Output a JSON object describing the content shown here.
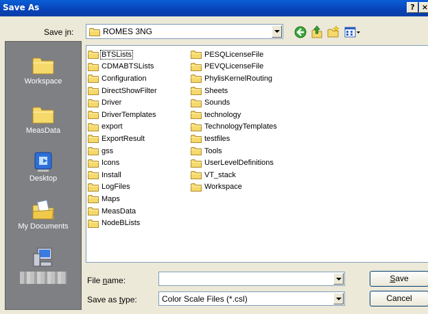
{
  "window": {
    "title": "Save As",
    "help_label": "?",
    "close_label": "×"
  },
  "toolbar": {
    "save_in_label_pre": "Save ",
    "save_in_label_u": "i",
    "save_in_label_post": "n:",
    "save_in_value": "ROMES 3NG",
    "icons": [
      "back-icon",
      "up-folder-icon",
      "new-folder-icon",
      "views-menu-icon"
    ]
  },
  "places": [
    {
      "label": "Workspace",
      "icon": "folder-icon"
    },
    {
      "label": "MeasData",
      "icon": "folder-icon"
    },
    {
      "label": "Desktop",
      "icon": "desktop-icon"
    },
    {
      "label": "My Documents",
      "icon": "my-documents-icon"
    },
    {
      "label": "",
      "icon": "my-computer-icon"
    }
  ],
  "files": {
    "column1": [
      "BTSLists",
      "CDMABTSLists",
      "Configuration",
      "DirectShowFilter",
      "Driver",
      "DriverTemplates",
      "export",
      "ExportResult",
      "gss",
      "Icons",
      "Install",
      "LogFiles",
      "Maps",
      "MeasData",
      "NodeBLists"
    ],
    "column2": [
      "PESQLicenseFile",
      "PEVQLicenseFile",
      "PhylisKernelRouting",
      "Sheets",
      "Sounds",
      "technology",
      "TechnologyTemplates",
      "testfiles",
      "Tools",
      "UserLevelDefinitions",
      "VT_stack",
      "Workspace"
    ],
    "selected": "BTSLists"
  },
  "filename": {
    "label_pre": "File ",
    "label_u": "n",
    "label_post": "ame:",
    "value": ""
  },
  "filetype": {
    "label_pre": "Save as ",
    "label_u": "t",
    "label_post": "ype:",
    "value": "Color Scale Files (*.csl)"
  },
  "buttons": {
    "save_u": "S",
    "save_rest": "ave",
    "cancel": "Cancel"
  },
  "colors": {
    "titlebar": "#0842b8",
    "dialog_bg": "#ece9d8",
    "places_bg": "#7f8083",
    "folder": "#f3d45b"
  }
}
